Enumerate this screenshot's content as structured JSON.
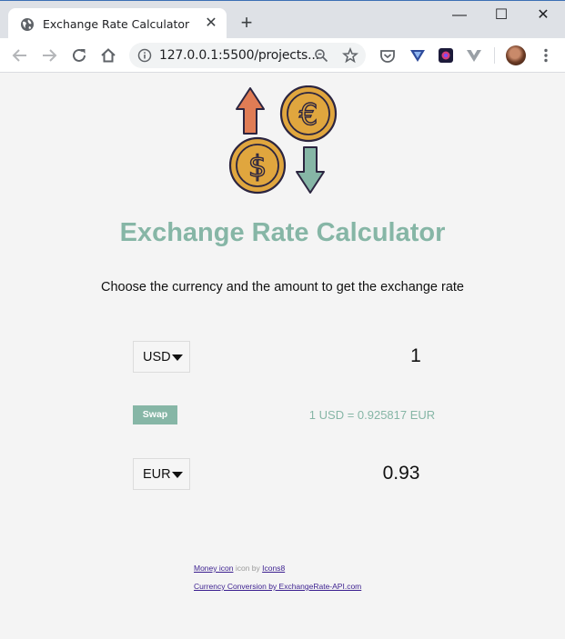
{
  "browser": {
    "tab_title": "Exchange Rate Calculator",
    "new_tab": "+",
    "url": "127.0.0.1:5500/projects...",
    "window_controls": {
      "minimize": "—",
      "maximize": "☐",
      "close": "✕"
    },
    "tab_close": "✕"
  },
  "page": {
    "title": "Exchange Rate Calculator",
    "subtitle": "Choose the currency and the amount to get the exchange rate",
    "currency_one": {
      "value": "USD",
      "amount": "1"
    },
    "currency_two": {
      "value": "EUR",
      "amount": "0.93"
    },
    "swap_label": "Swap",
    "rate_text": "1 USD = 0.925817 EUR",
    "credits": {
      "money_icon_link": "Money icon",
      "icon_by": " icon by ",
      "icons8_link": "Icons8",
      "api_link": "Currency Conversion by ExchangeRate-API.com"
    }
  },
  "colors": {
    "accent": "#86b6a6",
    "coin_gold": "#e0a63e",
    "arrow_up": "#e07c55",
    "arrow_down": "#86b6a6",
    "chrome": "#dee1e6"
  },
  "icons": [
    "globe-icon",
    "tab-close-icon",
    "new-tab-icon",
    "minimize-icon",
    "maximize-icon",
    "window-close-icon",
    "back-icon",
    "forward-icon",
    "reload-icon",
    "home-icon",
    "info-icon",
    "zoom-icon",
    "star-icon",
    "pocket-icon",
    "vpn-icon",
    "extension-icon",
    "vivaldi-icon",
    "avatar",
    "menu-icon",
    "money-exchange-icon",
    "caret-down-icon"
  ]
}
